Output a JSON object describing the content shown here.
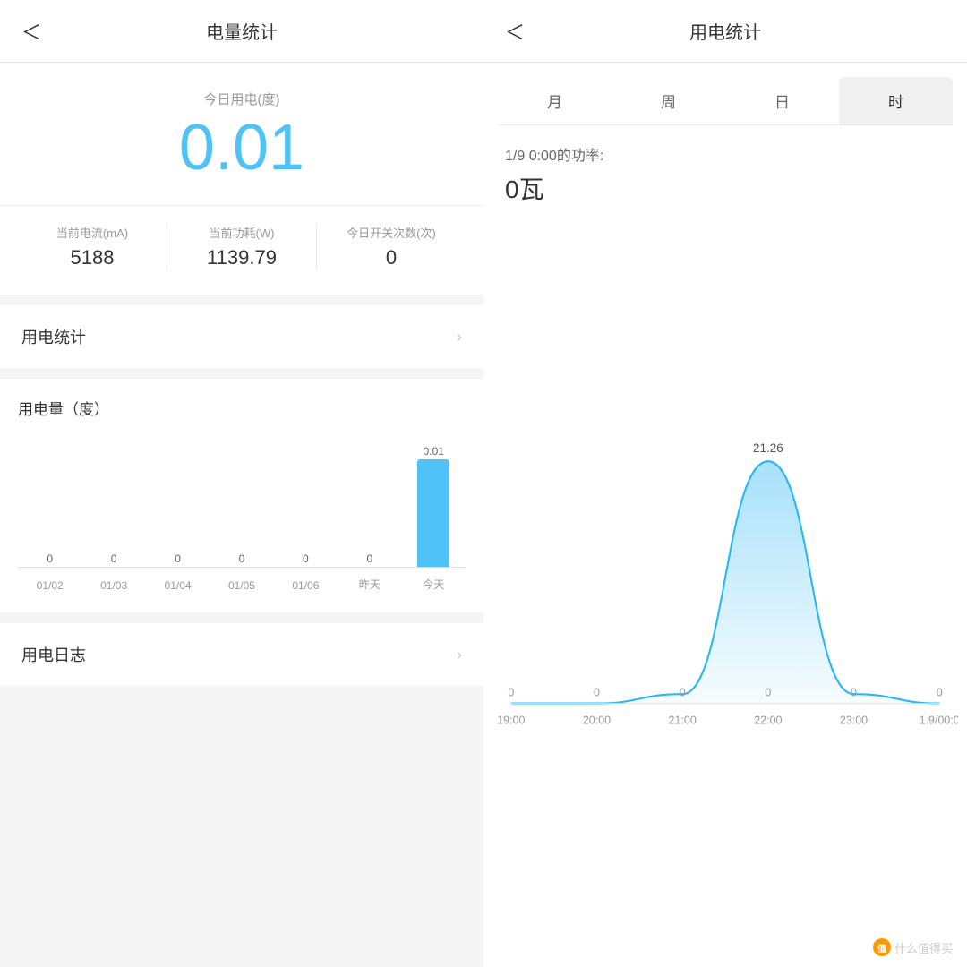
{
  "left": {
    "header": {
      "back_label": "＜",
      "title": "电量统计"
    },
    "today_usage": {
      "label": "今日用电(度)",
      "value": "0.01"
    },
    "stats": [
      {
        "label": "当前电流(mA)",
        "value": "5188"
      },
      {
        "label": "当前功耗(W)",
        "value": "1139.79"
      },
      {
        "label": "今日开关次数(次)",
        "value": "0"
      }
    ],
    "menu_items": [
      {
        "label": "用电统计"
      }
    ],
    "chart": {
      "title": "用电量（度）",
      "bars": [
        {
          "date": "01/02",
          "value": 0,
          "height": 0
        },
        {
          "date": "01/03",
          "value": 0,
          "height": 0
        },
        {
          "date": "01/04",
          "value": 0,
          "height": 0
        },
        {
          "date": "01/05",
          "value": 0,
          "height": 0
        },
        {
          "date": "01/06",
          "value": 0,
          "height": 0
        },
        {
          "date": "昨天",
          "value": 0,
          "height": 0
        },
        {
          "date": "今天",
          "value": 0.01,
          "height": 120
        }
      ]
    },
    "log_menu": {
      "label": "用电日志"
    }
  },
  "right": {
    "header": {
      "back_label": "＜",
      "title": "用电统计"
    },
    "tabs": [
      {
        "label": "月",
        "active": false
      },
      {
        "label": "周",
        "active": false
      },
      {
        "label": "日",
        "active": false
      },
      {
        "label": "时",
        "active": true
      }
    ],
    "power_info": {
      "timestamp": "1/9 0:00的功率:",
      "value": "0瓦"
    },
    "chart": {
      "peak_label": "21.26",
      "x_labels": [
        "19:00",
        "20:00",
        "21:00",
        "22:00",
        "23:00",
        "1.9/00:0"
      ],
      "y_zero_labels": [
        "0",
        "0",
        "0",
        "0",
        "0",
        "0"
      ]
    },
    "watermark": "什么值得买"
  }
}
